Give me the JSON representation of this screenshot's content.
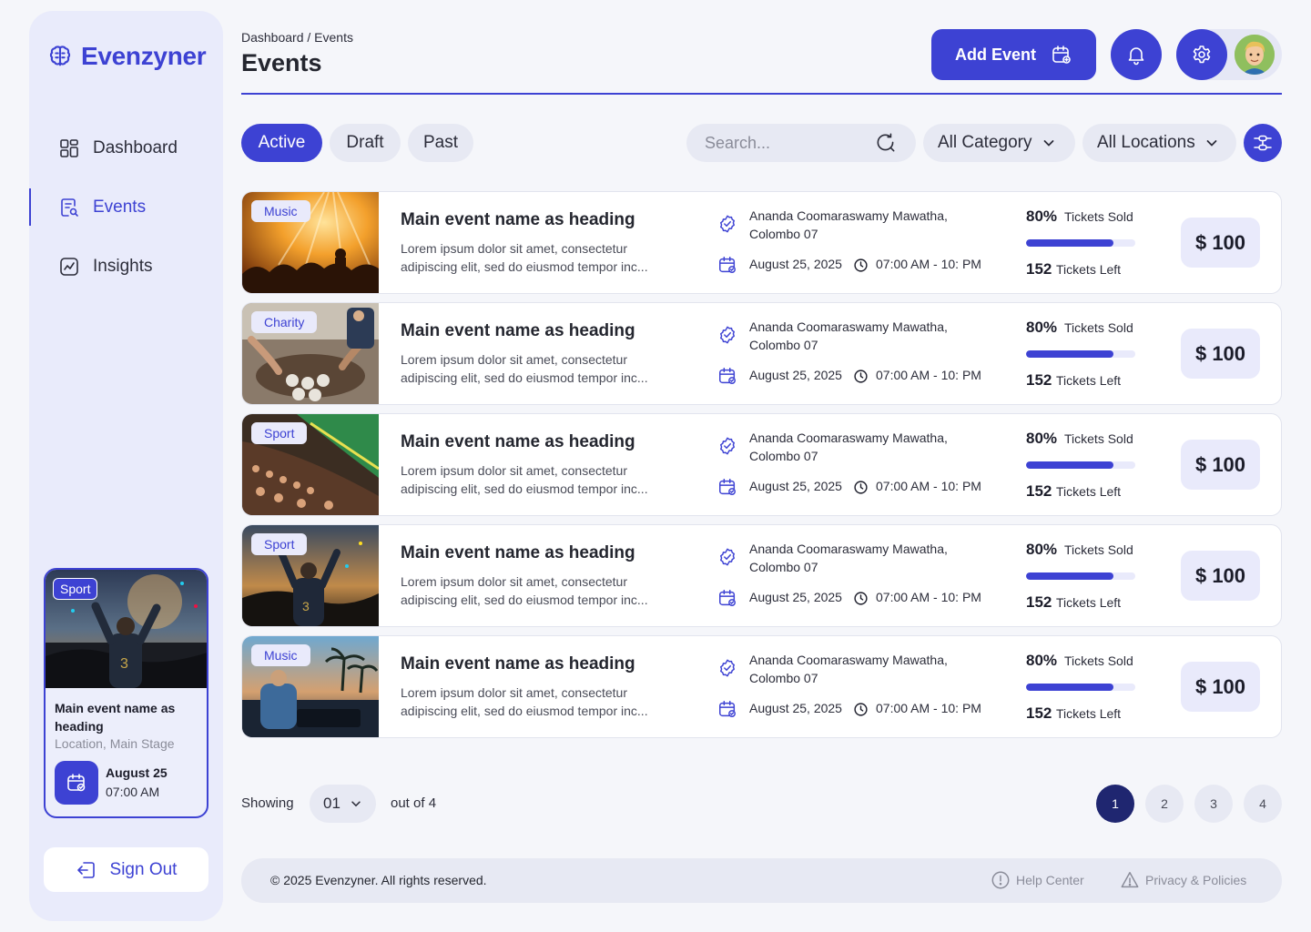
{
  "app": {
    "name": "Evenzyner"
  },
  "sidebar": {
    "items": [
      {
        "label": "Dashboard",
        "icon": "grid-icon"
      },
      {
        "label": "Events",
        "icon": "event-document-icon"
      },
      {
        "label": "Insights",
        "icon": "chart-icon"
      }
    ],
    "featured": {
      "badge": "Sport",
      "title": "Main event name as heading",
      "location": "Location, Main Stage",
      "date": "August 25",
      "time": "07:00 AM"
    },
    "sign_out": "Sign Out"
  },
  "header": {
    "breadcrumb": "Dashboard / Events",
    "title": "Events",
    "add_event": "Add Event"
  },
  "filters": {
    "tabs": [
      "Active",
      "Draft",
      "Past"
    ],
    "active_tab": "Active",
    "search_placeholder": "Search...",
    "category": "All Category",
    "location": "All Locations"
  },
  "events": [
    {
      "tag": "Music",
      "title": "Main event name as heading",
      "description": "Lorem ipsum dolor sit amet, consectetur adipiscing elit, sed do eiusmod tempor inc...",
      "location": "Ananda Coomaraswamy Mawatha, Colombo 07",
      "date": "August 25, 2025",
      "time": "07:00 AM - 10: PM",
      "sold_pct": "80%",
      "sold_label": "Tickets Sold",
      "sold_fraction": 0.8,
      "left": "152",
      "left_label": "Tickets Left",
      "price": "$ 100"
    },
    {
      "tag": "Charity",
      "title": "Main event name as heading",
      "description": "Lorem ipsum dolor sit amet, consectetur adipiscing elit, sed do eiusmod tempor inc...",
      "location": "Ananda Coomaraswamy Mawatha, Colombo 07",
      "date": "August 25, 2025",
      "time": "07:00 AM - 10: PM",
      "sold_pct": "80%",
      "sold_label": "Tickets Sold",
      "sold_fraction": 0.8,
      "left": "152",
      "left_label": "Tickets Left",
      "price": "$ 100"
    },
    {
      "tag": "Sport",
      "title": "Main event name as heading",
      "description": "Lorem ipsum dolor sit amet, consectetur adipiscing elit, sed do eiusmod tempor inc...",
      "location": "Ananda Coomaraswamy Mawatha, Colombo 07",
      "date": "August 25, 2025",
      "time": "07:00 AM - 10: PM",
      "sold_pct": "80%",
      "sold_label": "Tickets Sold",
      "sold_fraction": 0.8,
      "left": "152",
      "left_label": "Tickets Left",
      "price": "$ 100"
    },
    {
      "tag": "Sport",
      "title": "Main event name as heading",
      "description": "Lorem ipsum dolor sit amet, consectetur adipiscing elit, sed do eiusmod tempor inc...",
      "location": "Ananda Coomaraswamy Mawatha, Colombo 07",
      "date": "August 25, 2025",
      "time": "07:00 AM - 10: PM",
      "sold_pct": "80%",
      "sold_label": "Tickets Sold",
      "sold_fraction": 0.8,
      "left": "152",
      "left_label": "Tickets Left",
      "price": "$ 100"
    },
    {
      "tag": "Music",
      "title": "Main event name as heading",
      "description": "Lorem ipsum dolor sit amet, consectetur adipiscing elit, sed do eiusmod tempor inc...",
      "location": "Ananda Coomaraswamy Mawatha, Colombo 07",
      "date": "August 25, 2025",
      "time": "07:00 AM - 10: PM",
      "sold_pct": "80%",
      "sold_label": "Tickets Sold",
      "sold_fraction": 0.8,
      "left": "152",
      "left_label": "Tickets Left",
      "price": "$ 100"
    }
  ],
  "pagination": {
    "showing": "Showing",
    "per_page": "01",
    "out_of": "out of 4",
    "pages": [
      "1",
      "2",
      "3",
      "4"
    ],
    "current": "1"
  },
  "footer": {
    "copyright": "© 2025 Evenzyner. All rights reserved.",
    "help": "Help Center",
    "privacy": "Privacy & Policies"
  },
  "colors": {
    "accent": "#3d42d3",
    "sidebar_bg": "#e9ebfb",
    "page_bg": "#f5f6fa",
    "pagination_current": "#1f2670"
  }
}
